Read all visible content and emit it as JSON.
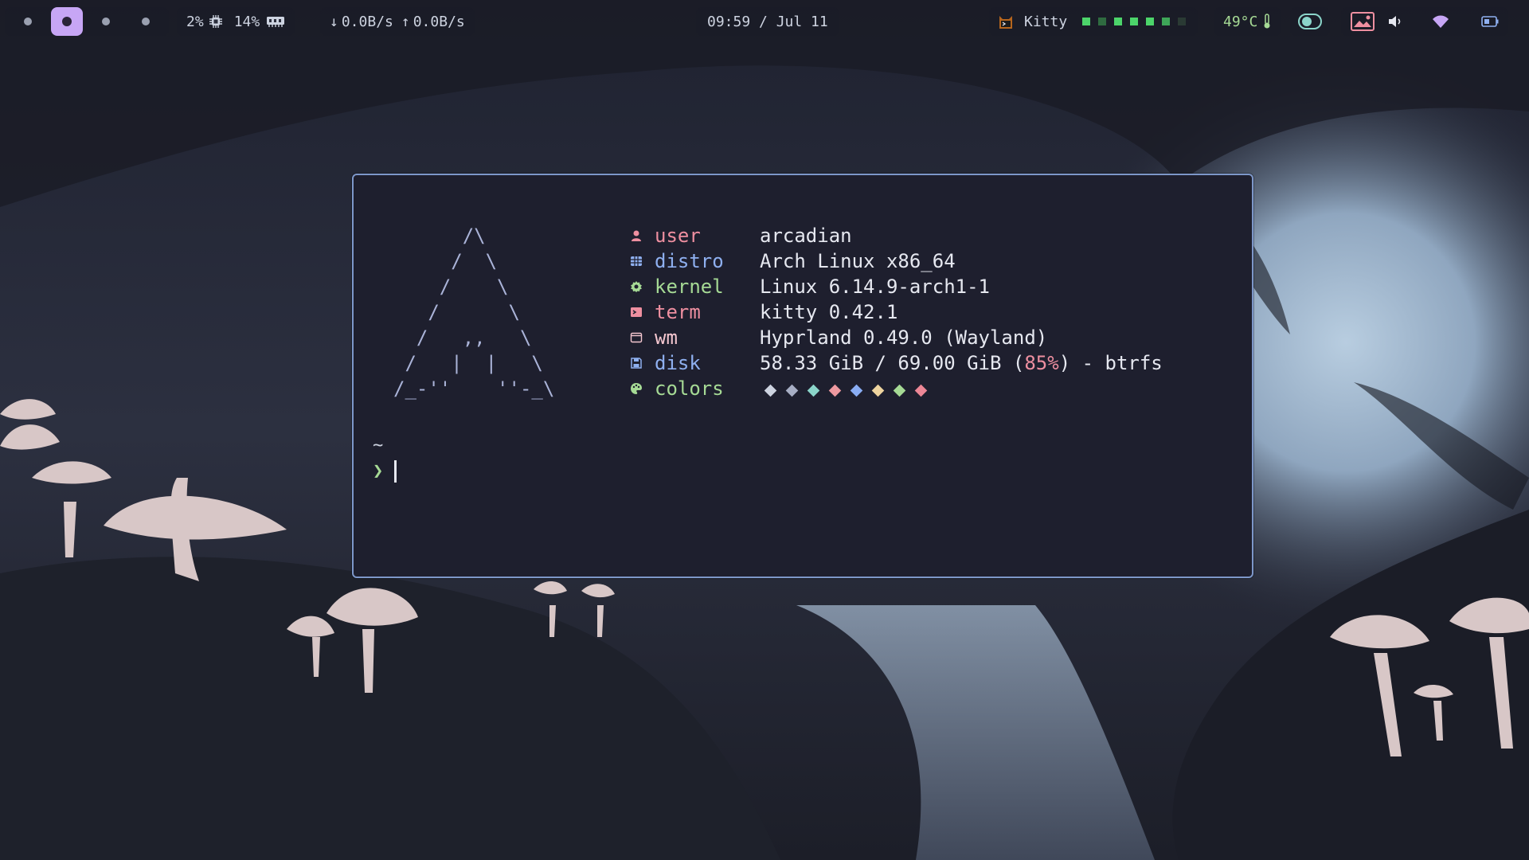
{
  "bar": {
    "cpu": "2%",
    "mem": "14%",
    "net_down": "0.0B/s",
    "net_up": "0.0B/s",
    "clock": "09:59 / Jul 11",
    "window_title": "Kitty",
    "temp": "49°C"
  },
  "fetch": {
    "ascii": [
      "      /\\",
      "     /  \\",
      "    /    \\",
      "   /      \\",
      "  /   ,,   \\",
      " /   |  |   \\",
      "/_-''    ''-_\\"
    ],
    "rows": [
      {
        "label": "user",
        "value": "arcadian",
        "label_color": "#ee8fa0",
        "icon": "user-icon"
      },
      {
        "label": "distro",
        "value": "Arch Linux x86_64",
        "label_color": "#8fb0f0",
        "icon": "distro-icon"
      },
      {
        "label": "kernel",
        "value": "Linux 6.14.9-arch1-1",
        "label_color": "#a6da95",
        "icon": "gear-icon"
      },
      {
        "label": "term",
        "value": "kitty 0.42.1",
        "label_color": "#ee8fa0",
        "icon": "terminal-icon"
      },
      {
        "label": "wm",
        "value": "Hyprland 0.49.0 (Wayland)",
        "label_color": "#f5c7d0",
        "icon": "window-icon"
      },
      {
        "label": "disk",
        "value_pre": "58.33 GiB / 69.00 GiB (",
        "value_pct": "85%",
        "value_post": ") - btrfs",
        "label_color": "#8fb0f0",
        "icon": "disk-icon"
      },
      {
        "label": "colors",
        "label_color": "#a6da95",
        "icon": "palette-icon"
      }
    ],
    "color_swatches": [
      "#cdd3e0",
      "#a7aec4",
      "#8bd5ca",
      "#ee99a0",
      "#8aadf4",
      "#eed49f",
      "#a6da95",
      "#ed8796"
    ]
  },
  "prompt": {
    "path": "~",
    "symbol": "❯"
  },
  "colors": {
    "workspace_active": "#c7a6f5",
    "terminal_border": "#7d97c9",
    "temp": "#a6da95",
    "segments": [
      "#4cd46a",
      "#2f6b40",
      "#4cd46a",
      "#4cd46a",
      "#4cd46a",
      "#3ea658",
      "#2a3a34"
    ]
  }
}
